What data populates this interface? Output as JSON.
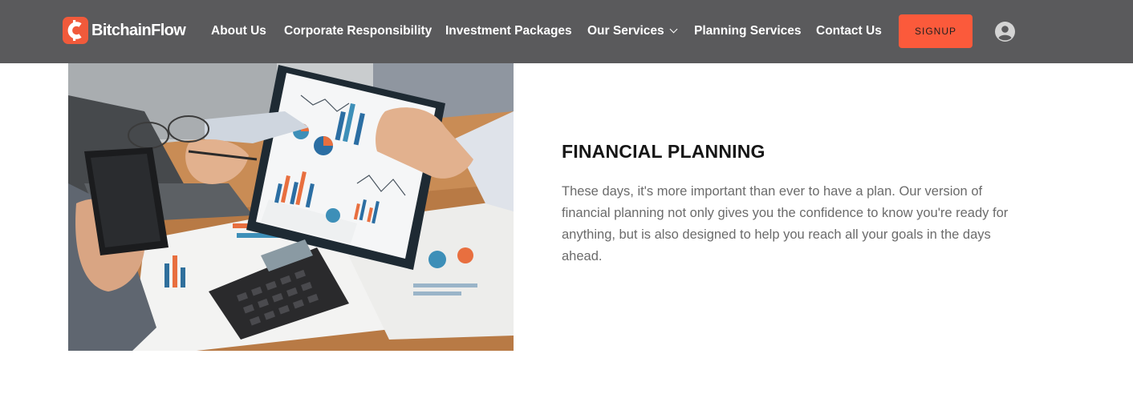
{
  "brand": {
    "name": "BitchainFlow",
    "accent_color": "#f15a3b"
  },
  "nav": {
    "items": [
      {
        "label": "About Us"
      },
      {
        "label": "Corporate Responsibility"
      },
      {
        "label": "Investment Packages"
      },
      {
        "label": "Our Services",
        "has_dropdown": true
      },
      {
        "label": "Planning Services"
      },
      {
        "label": "Contact Us"
      }
    ],
    "signup_label": "SIGNUP",
    "user_icon": "user-circle-icon"
  },
  "feature": {
    "image_icon": "financial-planning-photo",
    "title": "FINANCIAL PLANNING",
    "description": "These days, it's more important than ever to have a plan. Our version of financial planning not only gives you the confidence to know you're ready for anything, but is also designed to help you reach all your goals in the days ahead."
  }
}
